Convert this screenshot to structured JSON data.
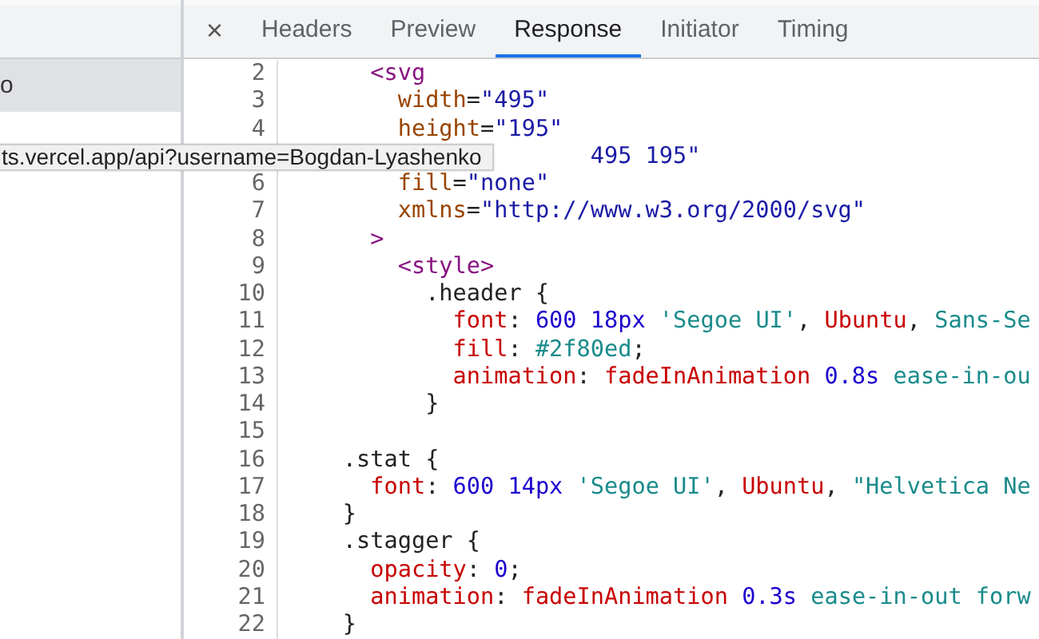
{
  "sidebar": {
    "items": [
      {
        "label": "o",
        "selected": true
      }
    ]
  },
  "tabs": [
    {
      "label": "Headers",
      "selected": false
    },
    {
      "label": "Preview",
      "selected": false
    },
    {
      "label": "Response",
      "selected": true
    },
    {
      "label": "Initiator",
      "selected": false
    },
    {
      "label": "Timing",
      "selected": false
    }
  ],
  "close_icon": "×",
  "tooltip": "ts.vercel.app/api?username=Bogdan-Lyashenko",
  "code_lines": [
    {
      "number": "2",
      "tokens": [
        {
          "text": "      <svg",
          "kind": "tag"
        }
      ]
    },
    {
      "number": "3",
      "tokens": [
        {
          "text": "        width",
          "kind": "attr"
        },
        {
          "text": "=",
          "kind": "plain"
        },
        {
          "text": "\"495\"",
          "kind": "str"
        }
      ]
    },
    {
      "number": "4",
      "tokens": [
        {
          "text": "        height",
          "kind": "attr"
        },
        {
          "text": "=",
          "kind": "plain"
        },
        {
          "text": "\"195\"",
          "kind": "str"
        }
      ]
    },
    {
      "tokens": [
        {
          "text": "                      495 195\"",
          "kind": "str"
        }
      ]
    },
    {
      "number": "6",
      "tokens": [
        {
          "text": "        fill",
          "kind": "attr"
        },
        {
          "text": "=",
          "kind": "plain"
        },
        {
          "text": "\"none\"",
          "kind": "str"
        }
      ]
    },
    {
      "number": "7",
      "tokens": [
        {
          "text": "        xmlns",
          "kind": "attr"
        },
        {
          "text": "=",
          "kind": "plain"
        },
        {
          "text": "\"http://www.w3.org/2000/svg\"",
          "kind": "str"
        }
      ]
    },
    {
      "number": "8",
      "tokens": [
        {
          "text": "      >",
          "kind": "tag"
        }
      ]
    },
    {
      "number": "9",
      "tokens": [
        {
          "text": "        <style>",
          "kind": "tag"
        }
      ]
    },
    {
      "number": "10",
      "tokens": [
        {
          "text": "          .header {",
          "kind": "plain"
        }
      ]
    },
    {
      "number": "11",
      "tokens": [
        {
          "text": "            font",
          "kind": "prop"
        },
        {
          "text": ": ",
          "kind": "plain"
        },
        {
          "text": "600 18px",
          "kind": "num"
        },
        {
          "text": " 'Segoe UI'",
          "kind": "kw"
        },
        {
          "text": ", ",
          "kind": "plain"
        },
        {
          "text": "Ubuntu",
          "kind": "prop"
        },
        {
          "text": ", ",
          "kind": "plain"
        },
        {
          "text": "Sans-Se",
          "kind": "kw"
        }
      ]
    },
    {
      "number": "12",
      "tokens": [
        {
          "text": "            fill",
          "kind": "prop"
        },
        {
          "text": ": ",
          "kind": "plain"
        },
        {
          "text": "#2f80ed",
          "kind": "kw"
        },
        {
          "text": ";",
          "kind": "plain"
        }
      ]
    },
    {
      "number": "13",
      "tokens": [
        {
          "text": "            animation",
          "kind": "prop"
        },
        {
          "text": ": ",
          "kind": "plain"
        },
        {
          "text": "fadeInAnimation",
          "kind": "prop"
        },
        {
          "text": " 0.8s",
          "kind": "num"
        },
        {
          "text": " ease-in-ou",
          "kind": "kw"
        }
      ]
    },
    {
      "number": "14",
      "tokens": [
        {
          "text": "          }",
          "kind": "plain"
        }
      ]
    },
    {
      "number": "15"
    },
    {
      "number": "16",
      "tokens": [
        {
          "text": "    .stat {",
          "kind": "plain"
        }
      ]
    },
    {
      "number": "17",
      "tokens": [
        {
          "text": "      font",
          "kind": "prop"
        },
        {
          "text": ": ",
          "kind": "plain"
        },
        {
          "text": "600 14px",
          "kind": "num"
        },
        {
          "text": " 'Segoe UI'",
          "kind": "kw"
        },
        {
          "text": ", ",
          "kind": "plain"
        },
        {
          "text": "Ubuntu",
          "kind": "prop"
        },
        {
          "text": ", ",
          "kind": "plain"
        },
        {
          "text": "\"Helvetica Ne",
          "kind": "kw"
        }
      ]
    },
    {
      "number": "18",
      "tokens": [
        {
          "text": "    }",
          "kind": "plain"
        }
      ]
    },
    {
      "number": "19",
      "tokens": [
        {
          "text": "    .stagger {",
          "kind": "plain"
        }
      ]
    },
    {
      "number": "20",
      "tokens": [
        {
          "text": "      opacity",
          "kind": "prop"
        },
        {
          "text": ": ",
          "kind": "plain"
        },
        {
          "text": "0",
          "kind": "num"
        },
        {
          "text": ";",
          "kind": "plain"
        }
      ]
    },
    {
      "number": "21",
      "tokens": [
        {
          "text": "      animation",
          "kind": "prop"
        },
        {
          "text": ": ",
          "kind": "plain"
        },
        {
          "text": "fadeInAnimation",
          "kind": "prop"
        },
        {
          "text": " 0.3s",
          "kind": "num"
        },
        {
          "text": " ease-in-out forw",
          "kind": "kw"
        }
      ]
    },
    {
      "number": "22",
      "tokens": [
        {
          "text": "    }",
          "kind": "plain"
        }
      ]
    }
  ]
}
